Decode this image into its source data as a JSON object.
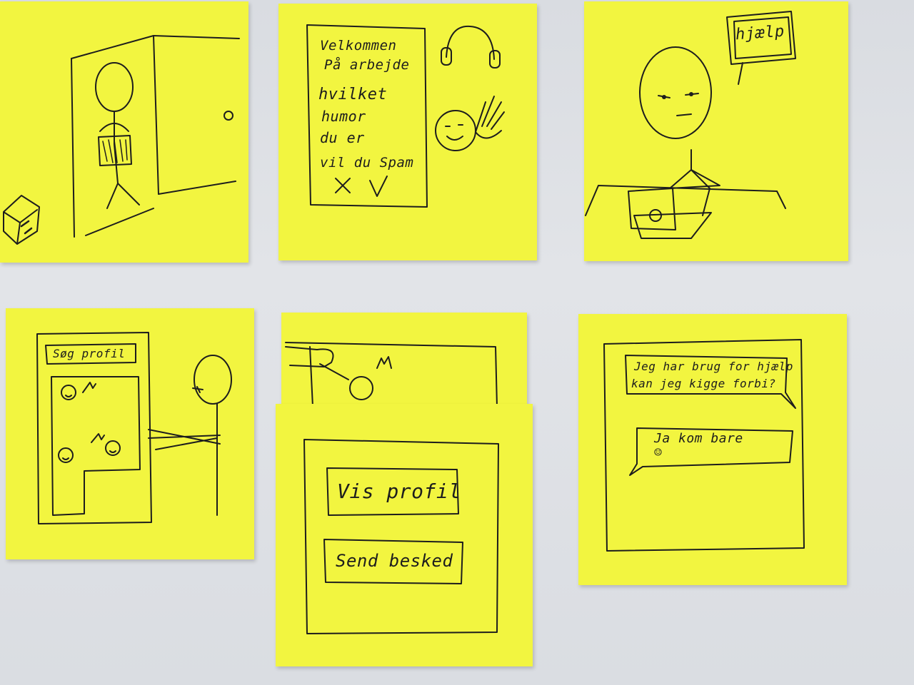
{
  "note1": {},
  "note2": {
    "lines": [
      "Velkommen",
      "På arbejde",
      "hvilket",
      "humor",
      "du er",
      "vil du Spam"
    ],
    "reject_mark": "X",
    "accept_mark": "V"
  },
  "note3": {
    "help_label": "hjælp"
  },
  "note4": {
    "search_label": "Søg profil"
  },
  "note5": {
    "view_profile_button": "Vis profil",
    "send_message_button": "Send besked"
  },
  "note6": {
    "message_sent": "Jeg har brug for hjælp kan jeg kigge forbi?",
    "message_sent_line1": "Jeg har brug for hjælp",
    "message_sent_line2": "kan jeg kigge forbi?",
    "message_reply": "Ja kom bare",
    "reply_emoji": "☺"
  },
  "colors": {
    "sticky_note": "#f2f540",
    "ink": "#1d1d1d",
    "background": "#dfe1e5"
  }
}
